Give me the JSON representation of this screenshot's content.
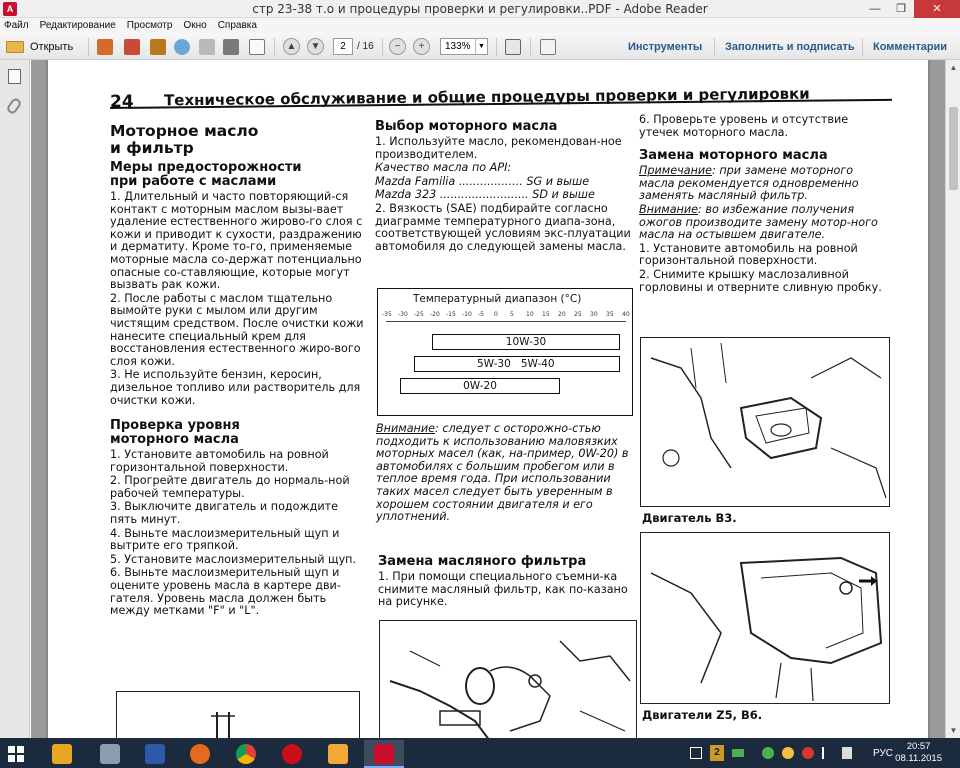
{
  "window": {
    "title": "стр 23-38 т.о и процедуры проверки и регулировки..PDF - Adobe Reader",
    "icon": "adobe-reader-icon",
    "buttons": [
      "minimize",
      "maximize",
      "close"
    ]
  },
  "menu": [
    "Файл",
    "Редактирование",
    "Просмотр",
    "Окно",
    "Справка"
  ],
  "toolbar": {
    "open_label": "Открыть",
    "page_current": "2",
    "page_total": "/ 16",
    "zoom": "133%",
    "tools_label": "Инструменты",
    "fill_sign_label": "Заполнить и подписать",
    "comments_label": "Комментарии"
  },
  "doc": {
    "page_number": "24",
    "header_title": "Техническое обслуживание и общие процедуры проверки и регулировки",
    "col1": {
      "h_oil": "Моторное масло",
      "h_oil2": "и фильтр",
      "h_safety": "Меры предосторожности",
      "h_safety2": "при работе с маслами",
      "p1": "1. Длительный и часто повторяющий-ся контакт с моторным маслом вызы-вает удаление естественного жирово-го слоя с кожи и приводит к сухости, раздражению и дерматиту. Кроме то-го, применяемые моторные масла со-держат потенциально опасные со-ставляющие, которые могут вызвать рак кожи.",
      "p2": "2. После работы с маслом тщательно вымойте руки с мылом или другим чистящим средством. После очистки кожи нанесите специальный крем для восстановления естественного жиро-вого слоя кожи.",
      "p3": "3. Не используйте бензин, керосин, дизельное топливо или растворитель для очистки кожи.",
      "h_check": "Проверка уровня",
      "h_check2": "моторного масла",
      "c1": "1. Установите автомобиль на ровной горизонтальной поверхности.",
      "c2": "2. Прогрейте двигатель до нормаль-ной рабочей температуры.",
      "c3": "3. Выключите двигатель и подождите пять минут.",
      "c4": "4. Выньте маслоизмерительный щуп и вытрите его тряпкой.",
      "c5": "5. Установите маслоизмерительный щуп.",
      "c6": "6. Выньте маслоизмерительный щуп и оцените уровень масла в картере дви-гателя. Уровень масла должен быть между метками \"F\" и \"L\"."
    },
    "col2": {
      "h_choice": "Выбор моторного масла",
      "p1": "1. Используйте масло, рекомендован-ное производителем.",
      "api_title": "Качество масла по API:",
      "api1_name": "Mazda Familia ..................",
      "api1_val": "SG и выше",
      "api2_name": "Mazda 323 .........................",
      "api2_val": "SD и выше",
      "p2": "2. Вязкость (SAE) подбирайте согласно диаграмме температурного диапа-зона, соответствующей условиям экс-плуатации автомобиля до следующей замены масла.",
      "chart_title": "Температурный диапазон (°C)",
      "chart_ticks": [
        "-35",
        "-30",
        "-25",
        "-20",
        "-15",
        "-10",
        "-5",
        "0",
        "5",
        "10",
        "15",
        "20",
        "25",
        "30",
        "35",
        "40"
      ],
      "band1": "10W-30",
      "band2a": "5W-30",
      "band2b": "5W-40",
      "band3": "0W-20",
      "warn_label": "Внимание",
      "warn_text": ": следует с осторожно-стью подходить к использованию маловязких моторных масел (как, на-пример, 0W-20) в автомобилях с большим пробегом или в теплое время года. При использовании таких масел следует быть уверенным в хорошем состоянии двигателя и его уплотнений.",
      "h_filter": "Замена масляного фильтра",
      "f1": "1. При помощи специального съемни-ка снимите масляный фильтр, как по-казано на рисунке."
    },
    "col3": {
      "p6": "6. Проверьте уровень и отсутствие утечек моторного масла.",
      "h_change": "Замена моторного масла",
      "note_label": "Примечание",
      "note_text": ": при замене моторного масла рекомендуется одновременно заменять масляный фильтр.",
      "warn_label": "Внимание",
      "warn_text": ": во избежание получения ожогов производите замену мотор-ного масла на остывшем двигателе.",
      "s1": "1. Установите автомобиль на ровной горизонтальной поверхности.",
      "s2": "2. Снимите крышку маслозаливной горловины и отверните сливную пробку.",
      "fig1_caption": "Двигатель B3.",
      "fig2_caption": "Двигатели Z5, B6."
    }
  },
  "taskbar": {
    "apps": [
      "file-explorer",
      "disk-utility",
      "firefox",
      "chrome",
      "opera",
      "photo-app",
      "adobe-reader"
    ],
    "lang": "РУС",
    "time": "20:57",
    "date": "08.11.2015",
    "badge": "2"
  }
}
